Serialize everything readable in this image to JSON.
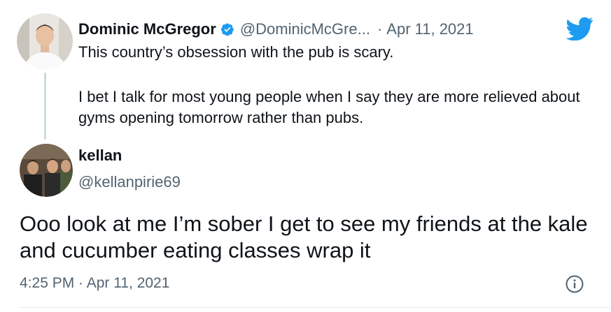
{
  "quoted_tweet": {
    "author_name": "Dominic McGregor",
    "author_handle": "@DominicMcGre...",
    "separator": "·",
    "date": "Apr 11, 2021",
    "text_line1": "This country’s obsession with the pub is scary.",
    "text_line2": "I bet I talk for most young people when I say they are more relieved about gyms opening tomorrow rather than pubs."
  },
  "reply_tweet": {
    "author_name": "kellan",
    "author_handle": "@kellanpirie69",
    "text": "Ooo look at me I’m sober I get to see my friends at the kale and cucumber eating classes wrap it",
    "timestamp": "4:25 PM · Apr 11, 2021"
  },
  "icons": {
    "verified": "verified-badge-icon",
    "brand": "twitter-bird-icon",
    "info": "info-icon"
  },
  "colors": {
    "brand_blue": "#1d9bf0",
    "muted_text": "#536471",
    "thread_line": "#cfd9de"
  }
}
